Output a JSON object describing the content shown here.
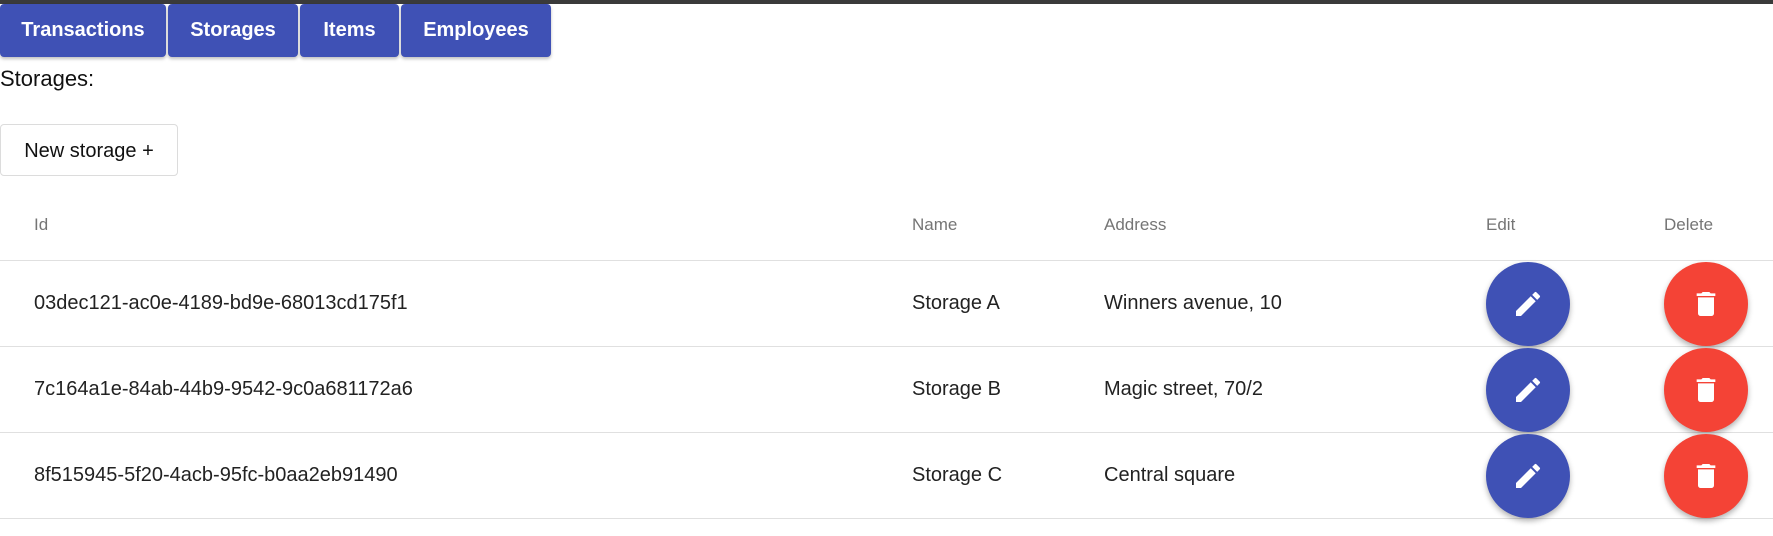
{
  "nav": {
    "items": [
      {
        "label": "Transactions"
      },
      {
        "label": "Storages"
      },
      {
        "label": "Items"
      },
      {
        "label": "Employees"
      }
    ]
  },
  "page": {
    "title": "Storages:",
    "new_button_label": "New storage +"
  },
  "table": {
    "headers": {
      "id": "Id",
      "name": "Name",
      "address": "Address",
      "edit": "Edit",
      "delete": "Delete"
    },
    "rows": [
      {
        "id": "03dec121-ac0e-4189-bd9e-68013cd175f1",
        "name": "Storage A",
        "address": "Winners avenue, 10"
      },
      {
        "id": "7c164a1e-84ab-44b9-9542-9c0a681172a6",
        "name": "Storage B",
        "address": "Magic street, 70/2"
      },
      {
        "id": "8f515945-5f20-4acb-95fc-b0aa2eb91490",
        "name": "Storage C",
        "address": "Central square"
      }
    ]
  },
  "icons": {
    "edit": "pencil-icon",
    "delete": "trash-icon"
  },
  "colors": {
    "primary": "#3f51b5",
    "danger": "#f44336"
  }
}
